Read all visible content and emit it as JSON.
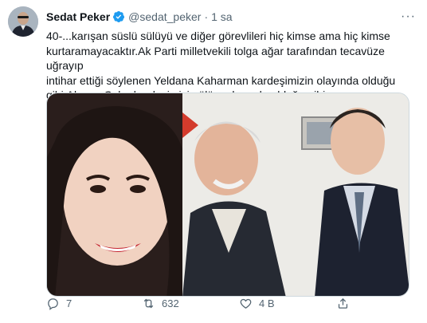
{
  "tweet": {
    "author_name": "Sedat Peker",
    "handle": "@sedat_peker",
    "separator": "·",
    "time": "1 sa",
    "more_label": "···",
    "text": "40-...karışan süslü sülüyü ve diğer görevlileri hiç kimse ama hiç kimse\nkurtaramayacaktır.Ak Parti milletvekili tolga ağar tarafından tecavüze uğrayıp\nintihar ettiği söylenen Yeldana Kaharman kardeşimizin olayında olduğu\ngibi,Aleyna Çakır kardeşimizin ölüm olayında olduğu gibi...",
    "verified_color": "#1d9bf0"
  },
  "actions": {
    "reply_count": "7",
    "retweet_count": "632",
    "like_count": "4 B",
    "icons": [
      "reply-icon",
      "retweet-icon",
      "like-icon",
      "share-icon"
    ]
  },
  "colors": {
    "text": "#0f1419",
    "secondary": "#536471",
    "border": "#cfd9de"
  }
}
